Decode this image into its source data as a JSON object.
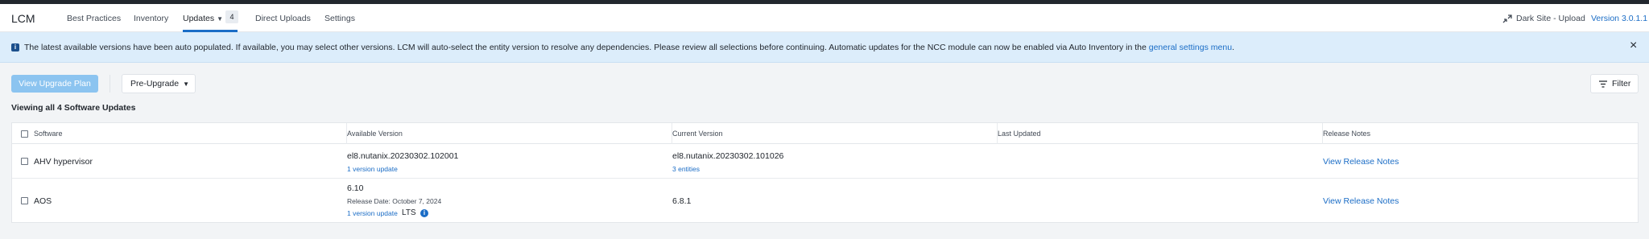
{
  "header": {
    "app_title": "LCM",
    "tabs": [
      {
        "label": "Best Practices"
      },
      {
        "label": "Inventory"
      },
      {
        "label": "Updates",
        "badge": "4"
      },
      {
        "label": "Direct Uploads"
      },
      {
        "label": "Settings"
      }
    ],
    "dark_site_label": "Dark Site - Upload",
    "version_label": "Version 3.0.1.1"
  },
  "banner": {
    "text": "The latest available versions have been auto populated. If available, you may select other versions. LCM will auto-select the entity version to resolve any dependencies. Please review all selections before continuing. Automatic updates for the NCC module can now be enabled via Auto Inventory in the ",
    "link_text": "general settings menu",
    "suffix": ".",
    "close_icon": "×"
  },
  "toolbar": {
    "view_plan_label": "View Upgrade Plan",
    "pre_upgrade_label": "Pre-Upgrade",
    "filter_label": "Filter"
  },
  "viewing_text": "Viewing all 4 Software Updates",
  "table": {
    "columns": [
      "Software",
      "Available Version",
      "Current Version",
      "Last Updated",
      "Release Notes"
    ],
    "rows": [
      {
        "software": "AHV hypervisor",
        "available_version": "el8.nutanix.20230302.102001",
        "available_sub": "1 version update",
        "current_version": "el8.nutanix.20230302.101026",
        "current_sub": "3 entities",
        "last_updated": "",
        "release_notes": "View Release Notes"
      },
      {
        "software": "AOS",
        "available_version": "6.10",
        "release_date": "Release Date: October 7, 2024",
        "available_sub": "1 version update",
        "lts": "LTS",
        "current_version": "6.8.1",
        "last_updated": "",
        "release_notes": "View Release Notes"
      }
    ]
  },
  "colors": {
    "accent": "#1b6dc6",
    "banner_bg": "#dcedfb",
    "primary_button": "#8cc4f0",
    "topstrip": "#22272e"
  }
}
